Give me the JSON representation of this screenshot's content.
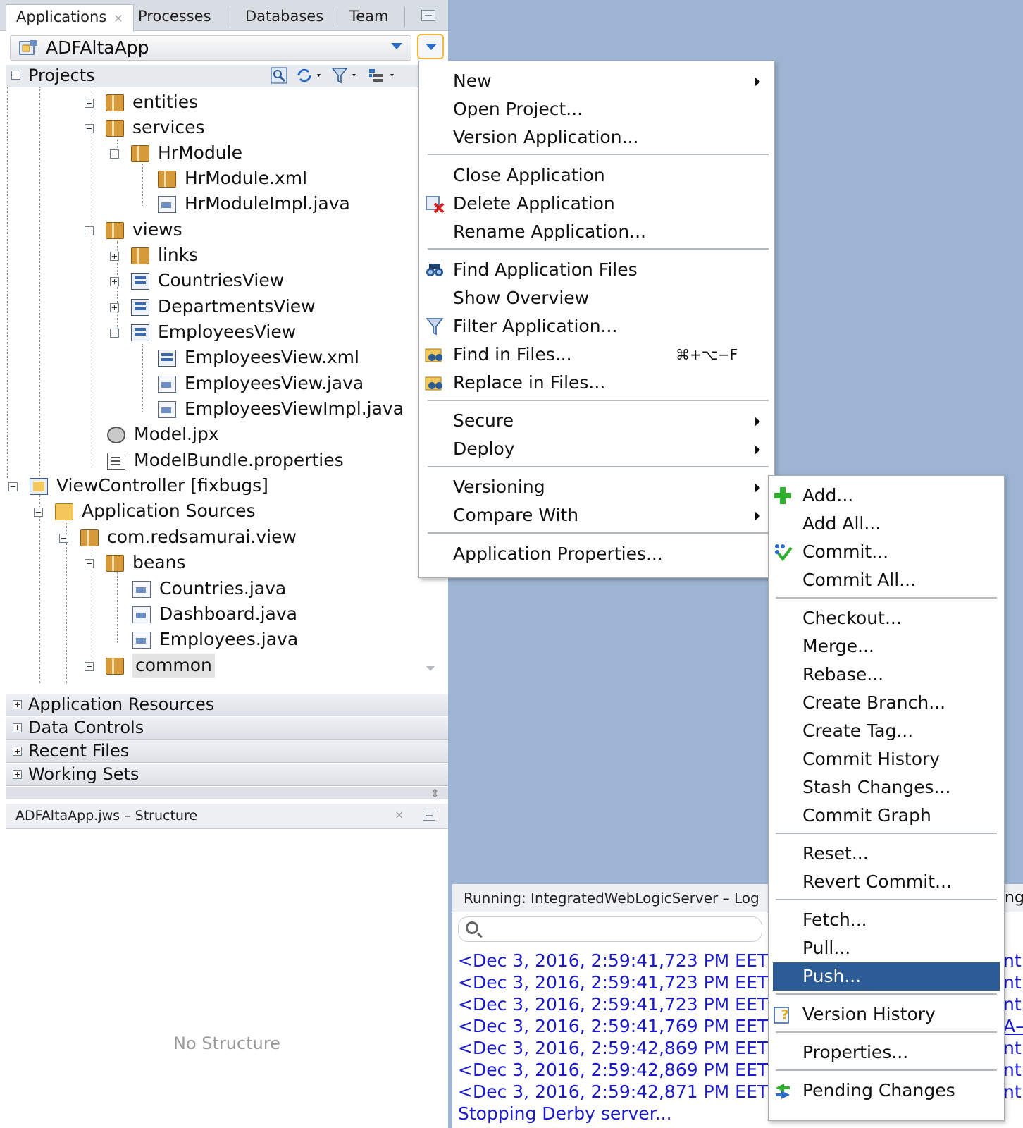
{
  "tabs": [
    {
      "label": "Applications"
    },
    {
      "label": "Processes"
    },
    {
      "label": "Databases"
    },
    {
      "label": "Team"
    }
  ],
  "app_selector": {
    "value": "ADFAltaApp"
  },
  "projects": {
    "label": "Projects"
  },
  "tree": [
    {
      "label": "entities"
    },
    {
      "label": "services"
    },
    {
      "label": "HrModule"
    },
    {
      "label": "HrModule.xml"
    },
    {
      "label": "HrModuleImpl.java"
    },
    {
      "label": "views"
    },
    {
      "label": "links"
    },
    {
      "label": "CountriesView"
    },
    {
      "label": "DepartmentsView"
    },
    {
      "label": "EmployeesView"
    },
    {
      "label": "EmployeesView.xml"
    },
    {
      "label": "EmployeesView.java"
    },
    {
      "label": "EmployeesViewImpl.java"
    },
    {
      "label": "Model.jpx"
    },
    {
      "label": "ModelBundle.properties"
    },
    {
      "label": "ViewController  [fixbugs]"
    },
    {
      "label": "Application Sources"
    },
    {
      "label": "com.redsamurai.view"
    },
    {
      "label": "beans"
    },
    {
      "label": "Countries.java"
    },
    {
      "label": "Dashboard.java"
    },
    {
      "label": "Employees.java"
    },
    {
      "label": "common"
    }
  ],
  "accordions": [
    {
      "label": "Application Resources"
    },
    {
      "label": "Data Controls"
    },
    {
      "label": "Recent Files"
    },
    {
      "label": "Working Sets"
    }
  ],
  "structure": {
    "title": "ADFAltaApp.jws – Structure",
    "empty_text": "No Structure"
  },
  "log": {
    "title": "Running: IntegratedWebLogicServer – Log",
    "lines": [
      "<Dec 3, 2016, 2:59:41,723 PM EET",
      "<Dec 3, 2016, 2:59:41,723 PM EET",
      "<Dec 3, 2016, 2:59:41,723 PM EET",
      "<Dec 3, 2016, 2:59:41,769 PM EET",
      "<Dec 3, 2016, 2:59:42,869 PM EET",
      "<Dec 3, 2016, 2:59:42,869 PM EET",
      "<Dec 3, 2016, 2:59:42,871 PM EET",
      "Stopping Derby server..."
    ],
    "right_fragments": [
      "nt",
      "nt",
      "nt",
      "A–",
      "nt",
      "nt",
      "nt"
    ],
    "right_header_fragment": "ng"
  },
  "app_menu": {
    "items": [
      {
        "label": "New"
      },
      {
        "label": "Open Project..."
      },
      {
        "label": "Version Application..."
      },
      {
        "label": "Close Application"
      },
      {
        "label": "Delete Application"
      },
      {
        "label": "Rename Application..."
      },
      {
        "label": "Find Application Files"
      },
      {
        "label": "Show Overview"
      },
      {
        "label": "Filter Application..."
      },
      {
        "label": "Find in Files...",
        "shortcut": "⌘+⌥−F"
      },
      {
        "label": "Replace in Files..."
      },
      {
        "label": "Secure"
      },
      {
        "label": "Deploy"
      },
      {
        "label": "Versioning"
      },
      {
        "label": "Compare With"
      },
      {
        "label": "Application Properties..."
      }
    ]
  },
  "versioning_menu": {
    "items": [
      {
        "label": "Add..."
      },
      {
        "label": "Add All..."
      },
      {
        "label": "Commit..."
      },
      {
        "label": "Commit All..."
      },
      {
        "label": "Checkout..."
      },
      {
        "label": "Merge..."
      },
      {
        "label": "Rebase..."
      },
      {
        "label": "Create Branch..."
      },
      {
        "label": "Create Tag..."
      },
      {
        "label": "Commit History"
      },
      {
        "label": "Stash Changes..."
      },
      {
        "label": "Commit Graph"
      },
      {
        "label": "Reset..."
      },
      {
        "label": "Revert Commit..."
      },
      {
        "label": "Fetch..."
      },
      {
        "label": "Pull..."
      },
      {
        "label": "Push...",
        "selected": true
      },
      {
        "label": "Version History"
      },
      {
        "label": "Properties..."
      },
      {
        "label": "Pending Changes"
      }
    ]
  },
  "colors": {
    "background": "#9db5d2",
    "menu_selection": "#2c5b95",
    "log_text": "#1b1bcc"
  }
}
